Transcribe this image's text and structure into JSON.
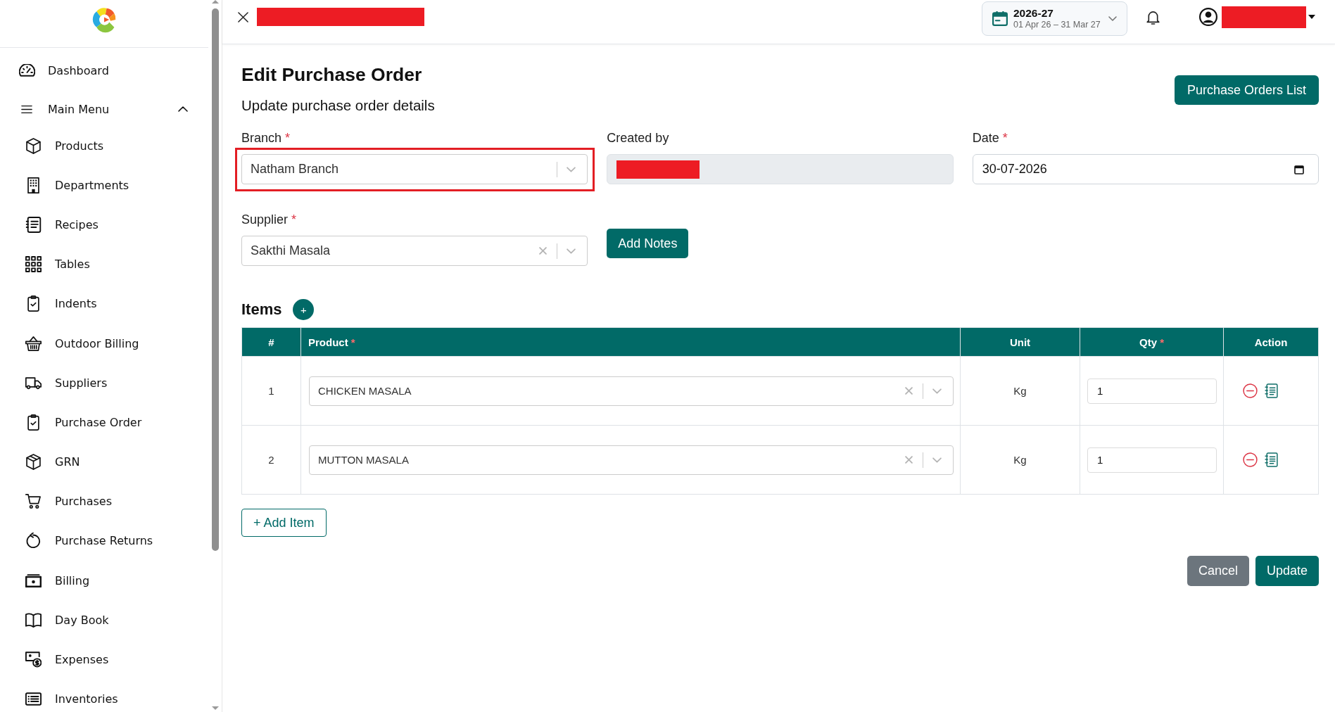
{
  "topbar": {
    "title_redacted": true,
    "fiscal_year": {
      "year": "2026-27",
      "range": "01 Apr 26 – 31 Mar 27"
    },
    "user": {
      "name_redacted": true
    }
  },
  "sidebar": {
    "items": [
      {
        "label": "Dashboard",
        "kind": "link"
      },
      {
        "label": "Main Menu",
        "kind": "group",
        "expanded": true,
        "children": [
          {
            "label": "Products"
          },
          {
            "label": "Departments"
          },
          {
            "label": "Recipes"
          },
          {
            "label": "Tables"
          },
          {
            "label": "Indents"
          },
          {
            "label": "Outdoor Billing"
          },
          {
            "label": "Suppliers"
          },
          {
            "label": "Purchase Order"
          },
          {
            "label": "GRN"
          },
          {
            "label": "Purchases"
          },
          {
            "label": "Purchase Returns"
          },
          {
            "label": "Billing"
          },
          {
            "label": "Day Book"
          },
          {
            "label": "Expenses"
          },
          {
            "label": "Inventories"
          }
        ]
      }
    ]
  },
  "page": {
    "title": "Edit Purchase Order",
    "subtitle": "Update purchase order details",
    "list_button": "Purchase Orders List"
  },
  "form": {
    "fields": [
      {
        "kind": "select",
        "label": "Branch",
        "required_mark": "*",
        "value": "Natham Branch",
        "clearable": false,
        "highlighted": true
      },
      {
        "kind": "readonly",
        "label": "Created by",
        "redacted": true
      },
      {
        "kind": "date",
        "label": "Date",
        "required_mark": "*",
        "value": "30-07-2026"
      },
      {
        "kind": "select",
        "label": "Supplier",
        "required_mark": "*",
        "value": "Sakthi Masala",
        "clearable": true,
        "highlighted": false
      },
      {
        "kind": "button",
        "label": "Add Notes"
      }
    ]
  },
  "items": {
    "heading": "Items",
    "add_button": "+",
    "columns": [
      {
        "label": "#"
      },
      {
        "label": "Product",
        "required_mark": "*"
      },
      {
        "label": "Unit"
      },
      {
        "label": "Qty",
        "required_mark": "*"
      },
      {
        "label": "Action"
      }
    ],
    "rows": [
      {
        "number": "1",
        "product": "CHICKEN MASALA",
        "unit": "Kg",
        "qty": "1"
      },
      {
        "number": "2",
        "product": "MUTTON MASALA",
        "unit": "Kg",
        "qty": "1"
      }
    ],
    "add_item_button": "+ Add Item"
  },
  "actions": [
    {
      "label": "Cancel",
      "kind": "secondary"
    },
    {
      "label": "Update",
      "kind": "primary"
    }
  ]
}
